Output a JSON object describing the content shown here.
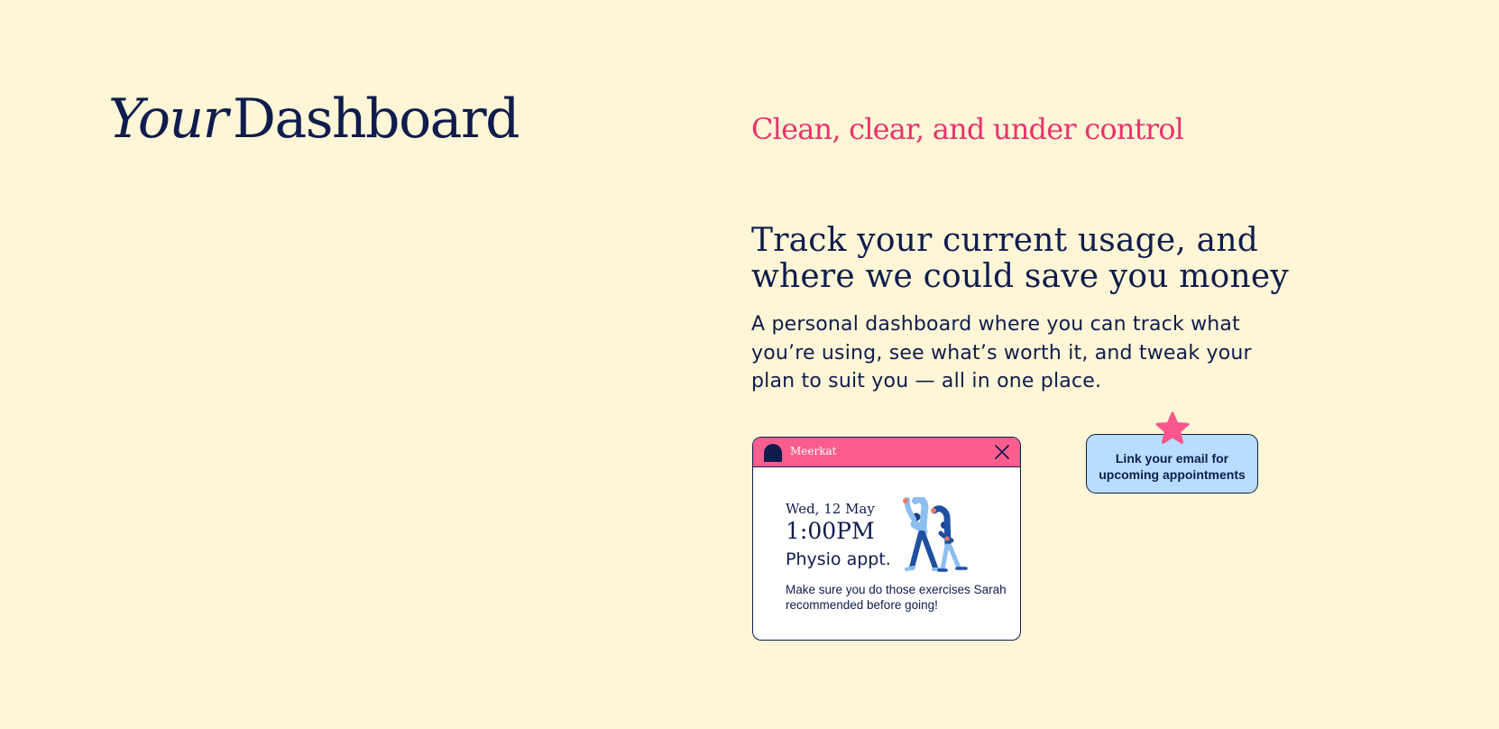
{
  "hero": {
    "title_italic": "Your",
    "title_rest": "Dashboard"
  },
  "intro": {
    "tagline": "Clean, clear, and under control",
    "headline": "Track your current usage, and where we could save you money",
    "description": "A personal dashboard where you can track what you’re using, see what’s worth it, and tweak your plan to suit you — all in one place."
  },
  "notification": {
    "app_name": "Meerkat",
    "date": "Wed, 12 May",
    "time": "1:00PM",
    "appointment": "Physio appt.",
    "note": "Make sure you do those exercises Sarah recommended before going!",
    "icons": {
      "app_logo": "meerkat-logo-icon",
      "close": "close-icon",
      "illustration": "exercise-illustration"
    }
  },
  "email_badge": {
    "label": "Link your email for upcoming appointments",
    "icon": "star-icon"
  },
  "colors": {
    "background": "#fef6d6",
    "navy": "#0f1c4d",
    "pink_accent": "#e8336e",
    "card_header": "#fc5d8f",
    "badge_blue": "#b9ddff",
    "star_pink": "#f9578d"
  }
}
